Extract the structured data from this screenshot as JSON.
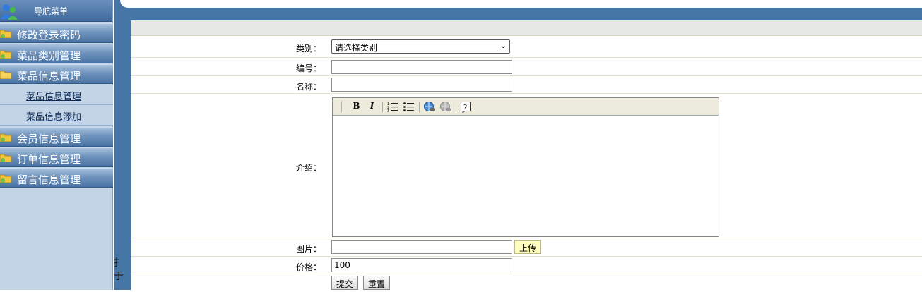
{
  "sidebar": {
    "title": "导航菜单",
    "menus": [
      {
        "label": "修改登录密码"
      },
      {
        "label": "菜品类别管理"
      },
      {
        "label": "菜品信息管理"
      },
      {
        "label": "会员信息管理"
      },
      {
        "label": "订单信息管理"
      },
      {
        "label": "留言信息管理"
      }
    ],
    "submenu": [
      {
        "label": "菜品信息管理"
      },
      {
        "label": "菜品信息添加"
      }
    ],
    "fragment": "扌\n于"
  },
  "form": {
    "category": {
      "label": "类别：",
      "value": "请选择类别"
    },
    "code": {
      "label": "编号：",
      "value": ""
    },
    "name": {
      "label": "名称：",
      "value": ""
    },
    "intro": {
      "label": "介绍：",
      "value": ""
    },
    "image": {
      "label": "图片：",
      "value": "",
      "upload_label": "上传"
    },
    "price": {
      "label": "价格：",
      "value": "100"
    },
    "submit_label": "提交",
    "reset_label": "重置"
  },
  "editor_toolbar": [
    "bold-icon",
    "italic-icon",
    "ordered-list-icon",
    "unordered-list-icon",
    "link-icon",
    "unlink-icon",
    "help-icon"
  ],
  "colors": {
    "frame_blue": "#4576a5",
    "sidebar_bg": "#c2d4e6",
    "row_border": "#dfe3c8",
    "upload_btn": "#ffffc0"
  }
}
